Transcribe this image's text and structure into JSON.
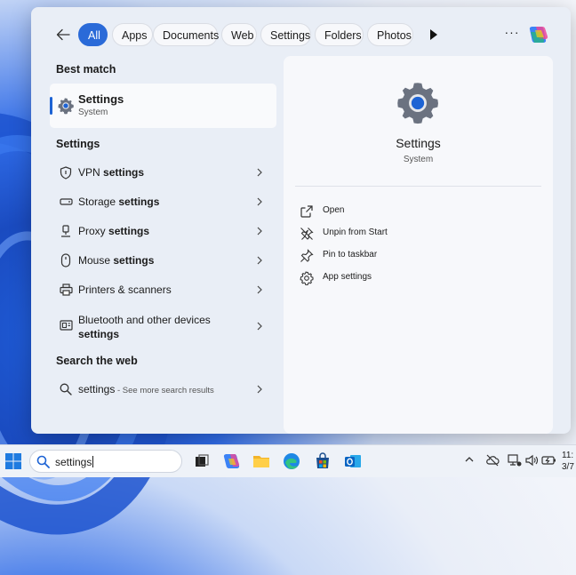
{
  "filters": {
    "tabs": [
      {
        "label": "All",
        "active": true
      },
      {
        "label": "Apps"
      },
      {
        "label": "Documents"
      },
      {
        "label": "Web"
      },
      {
        "label": "Settings"
      },
      {
        "label": "Folders"
      },
      {
        "label": "Photos"
      }
    ],
    "more_label": "···"
  },
  "left": {
    "best_match_heading": "Best match",
    "best_match": {
      "title": "Settings",
      "subtitle": "System"
    },
    "settings_heading": "Settings",
    "settings_items": [
      {
        "pre": "VPN ",
        "bold": "settings",
        "icon": "vpn-shield-icon"
      },
      {
        "pre": "Storage ",
        "bold": "settings",
        "icon": "storage-icon"
      },
      {
        "pre": "Proxy ",
        "bold": "settings",
        "icon": "proxy-icon"
      },
      {
        "pre": "Mouse ",
        "bold": "settings",
        "icon": "mouse-icon"
      },
      {
        "pre": "Printers & scanners",
        "bold": "",
        "icon": "printer-icon"
      },
      {
        "pre": "Bluetooth and other devices",
        "bold": "settings",
        "icon": "bluetooth-devices-icon"
      }
    ],
    "web_heading": "Search the web",
    "web_item": {
      "query": "settings",
      "suffix": " - See more search results",
      "icon": "search-icon"
    }
  },
  "right": {
    "title": "Settings",
    "subtitle": "System",
    "actions": [
      {
        "label": "Open",
        "icon": "open-external-icon"
      },
      {
        "label": "Unpin from Start",
        "icon": "unpin-icon"
      },
      {
        "label": "Pin to taskbar",
        "icon": "pin-icon"
      },
      {
        "label": "App settings",
        "icon": "gear-icon"
      }
    ]
  },
  "taskbar": {
    "search_value": "settings",
    "clock_time": "11:",
    "clock_date": "3/7"
  },
  "colors": {
    "accent": "#2a6ad8",
    "gear_blue": "#1d63d4",
    "gear_gray": "#6b7280"
  }
}
